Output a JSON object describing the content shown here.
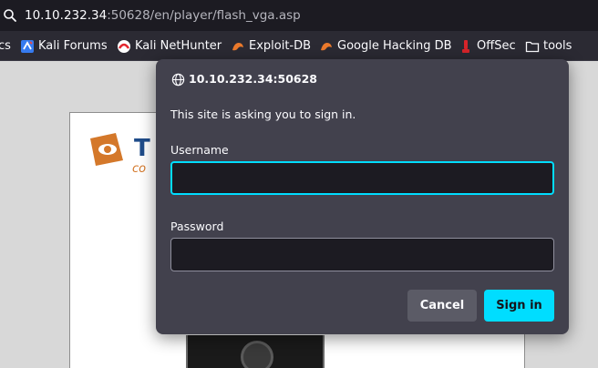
{
  "urlbar": {
    "host": "10.10.232.34",
    "path": ":50628/en/player/flash_vga.asp"
  },
  "bookmarks": [
    {
      "label": "cs",
      "icon": "none"
    },
    {
      "label": "Kali Forums",
      "icon": "kali-forums-icon"
    },
    {
      "label": "Kali NetHunter",
      "icon": "kali-nethunter-icon"
    },
    {
      "label": "Exploit-DB",
      "icon": "exploit-db-icon"
    },
    {
      "label": "Google Hacking DB",
      "icon": "ghdb-icon"
    },
    {
      "label": "OffSec",
      "icon": "offsec-icon"
    },
    {
      "label": "tools",
      "icon": "folder-icon"
    }
  ],
  "page": {
    "logo_letter": "T",
    "logo_subtext": "co"
  },
  "dialog": {
    "origin": "10.10.232.34:50628",
    "message": "This site is asking you to sign in.",
    "username_label": "Username",
    "username_value": "",
    "password_label": "Password",
    "password_value": "",
    "cancel_label": "Cancel",
    "signin_label": "Sign in"
  },
  "colors": {
    "accent": "#00ddff",
    "dialog_bg": "#42414d",
    "toolbar_bg": "#2b2a33",
    "urlbar_bg": "#1c1b22"
  }
}
